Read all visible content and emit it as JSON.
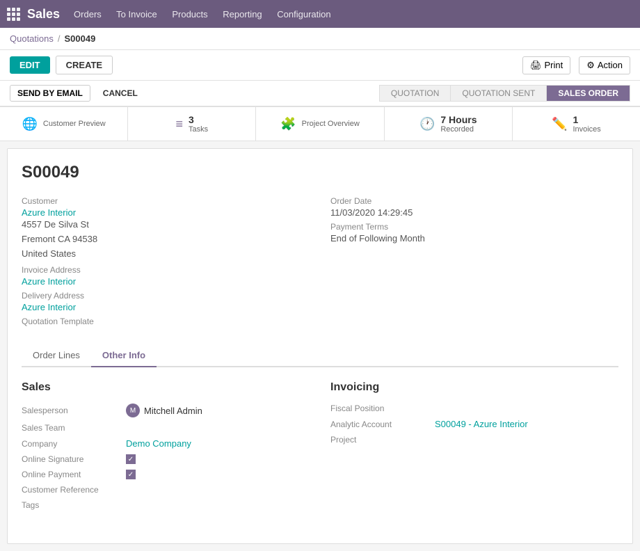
{
  "app": {
    "title": "Sales",
    "nav_items": [
      "Orders",
      "To Invoice",
      "Products",
      "Reporting",
      "Configuration"
    ]
  },
  "breadcrumb": {
    "parent": "Quotations",
    "separator": "/",
    "current": "S00049"
  },
  "toolbar": {
    "edit_label": "EDIT",
    "create_label": "CREATE",
    "print_label": "Print",
    "action_label": "Action"
  },
  "subbar": {
    "send_email_label": "SEND BY EMAIL",
    "cancel_label": "CANCEL"
  },
  "status_steps": [
    {
      "label": "QUOTATION",
      "active": false
    },
    {
      "label": "QUOTATION SENT",
      "active": false
    },
    {
      "label": "SALES ORDER",
      "active": true
    }
  ],
  "stats": [
    {
      "icon": "🌐",
      "num": "",
      "label": "Customer Preview"
    },
    {
      "icon": "≡",
      "num": "3",
      "label": "Tasks"
    },
    {
      "icon": "🧩",
      "num": "",
      "label": "Project Overview"
    },
    {
      "icon": "🕐",
      "num": "7 Hours",
      "label": "Recorded"
    },
    {
      "icon": "✏️",
      "num": "1",
      "label": "Invoices"
    }
  ],
  "order": {
    "id": "S00049"
  },
  "customer_section": {
    "customer_label": "Customer",
    "customer_name": "Azure Interior",
    "customer_address": "4557 De Silva St\nFremont CA 94538\nUnited States",
    "invoice_address_label": "Invoice Address",
    "invoice_address_value": "Azure Interior",
    "delivery_address_label": "Delivery Address",
    "delivery_address_value": "Azure Interior",
    "quotation_template_label": "Quotation Template"
  },
  "order_info": {
    "order_date_label": "Order Date",
    "order_date_value": "11/03/2020 14:29:45",
    "payment_terms_label": "Payment Terms",
    "payment_terms_value": "End of Following Month"
  },
  "tabs": [
    {
      "label": "Order Lines",
      "active": false
    },
    {
      "label": "Other Info",
      "active": true
    }
  ],
  "sales_section": {
    "title": "Sales",
    "salesperson_label": "Salesperson",
    "salesperson_name": "Mitchell Admin",
    "sales_team_label": "Sales Team",
    "company_label": "Company",
    "company_value": "Demo Company",
    "online_signature_label": "Online Signature",
    "online_payment_label": "Online Payment",
    "customer_reference_label": "Customer Reference",
    "tags_label": "Tags"
  },
  "invoicing_section": {
    "title": "Invoicing",
    "fiscal_position_label": "Fiscal Position",
    "analytic_account_label": "Analytic Account",
    "analytic_account_value": "S00049 - Azure Interior",
    "project_label": "Project"
  }
}
